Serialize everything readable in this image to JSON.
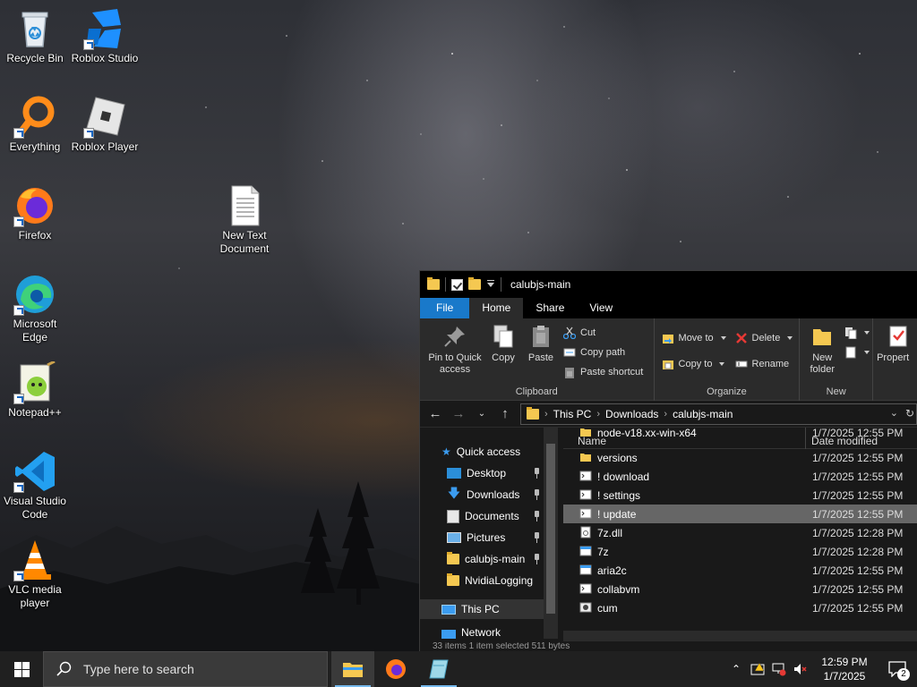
{
  "desktop": {
    "icons": [
      {
        "label": "Recycle Bin"
      },
      {
        "label": "Roblox Studio"
      },
      {
        "label": "Everything"
      },
      {
        "label": "Roblox Player"
      },
      {
        "label": "Firefox"
      },
      {
        "label": "New Text Document"
      },
      {
        "label": "Microsoft Edge"
      },
      {
        "label": "Notepad++"
      },
      {
        "label": "Visual Studio Code"
      },
      {
        "label": "VLC media player"
      }
    ]
  },
  "explorer": {
    "title": "calubjs-main",
    "tabs": {
      "file": "File",
      "home": "Home",
      "share": "Share",
      "view": "View"
    },
    "ribbon": {
      "clipboard": {
        "label": "Clipboard",
        "pin": "Pin to Quick access",
        "copy": "Copy",
        "paste": "Paste",
        "cut": "Cut",
        "copy_path": "Copy path",
        "paste_shortcut": "Paste shortcut"
      },
      "organize": {
        "label": "Organize",
        "move_to": "Move to",
        "copy_to": "Copy to",
        "delete": "Delete",
        "rename": "Rename"
      },
      "new": {
        "label": "New",
        "new_folder": "New folder"
      },
      "open": {
        "properties": "Propert"
      }
    },
    "address": {
      "crumbs": [
        "This PC",
        "Downloads",
        "calubjs-main"
      ]
    },
    "nav": {
      "quick_access": "Quick access",
      "items": [
        "Desktop",
        "Downloads",
        "Documents",
        "Pictures",
        "calubjs-main",
        "NvidiaLogging"
      ],
      "this_pc": "This PC",
      "network": "Network"
    },
    "columns": {
      "name": "Name",
      "date": "Date modified"
    },
    "files": [
      {
        "name": "node-v18.xx-win-x64",
        "date": "1/7/2025 12:55 PM",
        "type": "folder"
      },
      {
        "name": "versions",
        "date": "1/7/2025 12:55 PM",
        "type": "folder"
      },
      {
        "name": "! download",
        "date": "1/7/2025 12:55 PM",
        "type": "script"
      },
      {
        "name": "! settings",
        "date": "1/7/2025 12:55 PM",
        "type": "script"
      },
      {
        "name": "! update",
        "date": "1/7/2025 12:55 PM",
        "type": "script"
      },
      {
        "name": "7z.dll",
        "date": "1/7/2025 12:28 PM",
        "type": "dll"
      },
      {
        "name": "7z",
        "date": "1/7/2025 12:28 PM",
        "type": "exe"
      },
      {
        "name": "aria2c",
        "date": "1/7/2025 12:55 PM",
        "type": "exe"
      },
      {
        "name": "collabvm",
        "date": "1/7/2025 12:55 PM",
        "type": "script"
      },
      {
        "name": "cum",
        "date": "1/7/2025 12:55 PM",
        "type": "bat"
      }
    ],
    "status": "33 items    1 item selected  511 bytes"
  },
  "taskbar": {
    "search_placeholder": "Type here to search",
    "time": "12:59 PM",
    "date": "1/7/2025",
    "notification_count": "2"
  },
  "colors": {
    "accent": "#1979ca",
    "folder": "#f5c851",
    "taskbar": "#202020",
    "window_bg": "#191919",
    "ribbon_bg": "#2b2b2b"
  }
}
